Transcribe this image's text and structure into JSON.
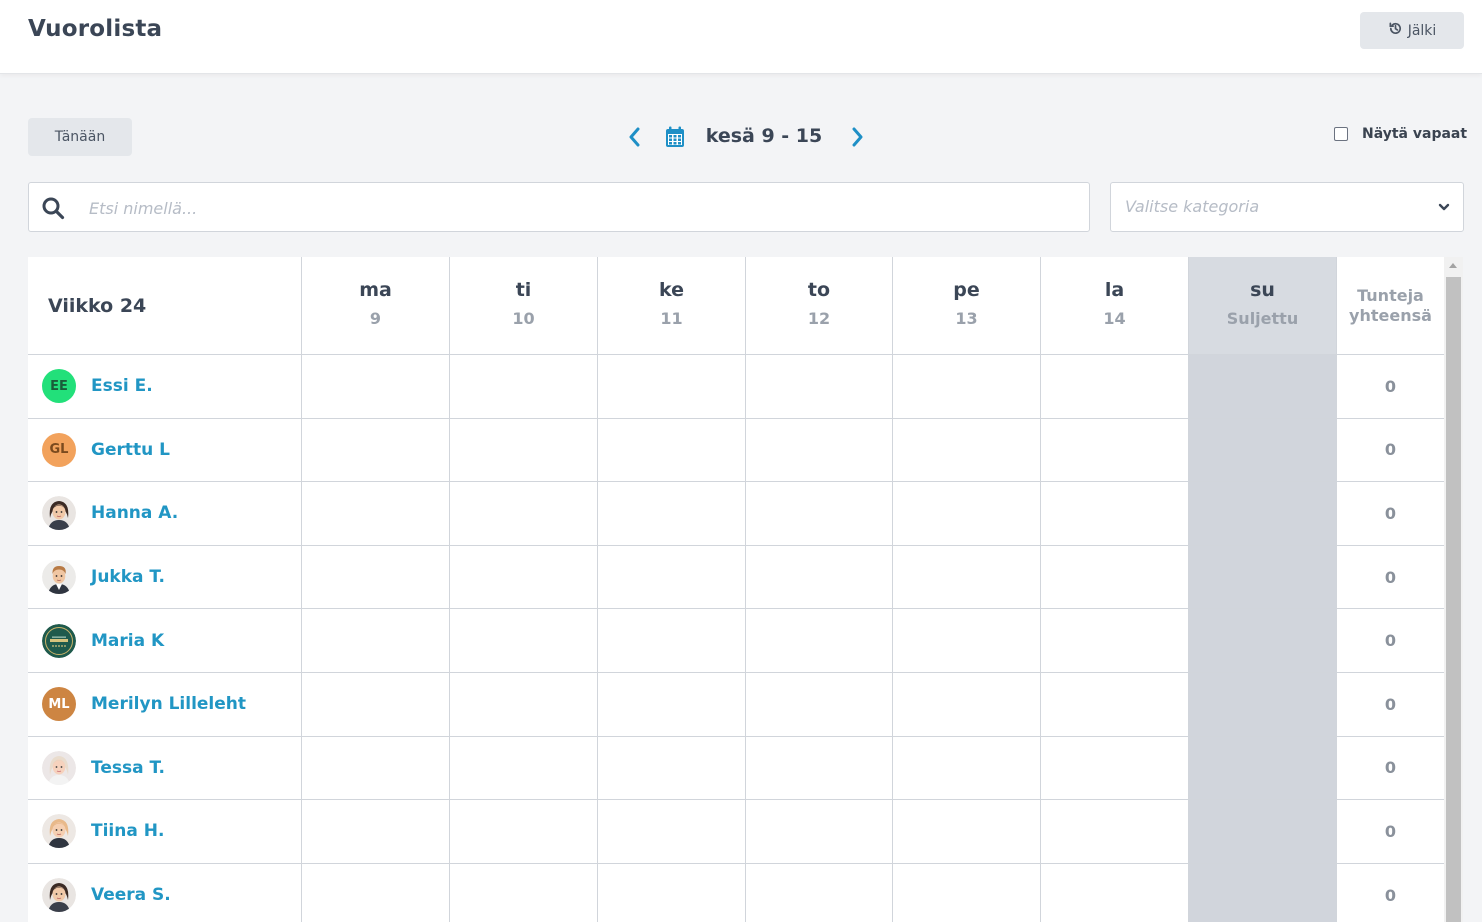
{
  "header": {
    "title": "Vuorolista",
    "back_label": "Jälki"
  },
  "toolbar": {
    "today_label": "Tänään",
    "date_range": "kesä 9 - 15",
    "show_free_label": "Näytä vapaat",
    "show_free_checked": false
  },
  "search": {
    "placeholder": "Etsi nimellä...",
    "value": ""
  },
  "category": {
    "placeholder": "Valitse kategoria"
  },
  "schedule": {
    "week_label": "Viikko 24",
    "days": [
      {
        "name": "ma",
        "number": "9",
        "closed": false
      },
      {
        "name": "ti",
        "number": "10",
        "closed": false
      },
      {
        "name": "ke",
        "number": "11",
        "closed": false
      },
      {
        "name": "to",
        "number": "12",
        "closed": false
      },
      {
        "name": "pe",
        "number": "13",
        "closed": false
      },
      {
        "name": "la",
        "number": "14",
        "closed": false
      },
      {
        "name": "su",
        "number": "Suljettu",
        "closed": true
      }
    ],
    "total_header": [
      "Tunteja",
      "yhteensä"
    ],
    "employees": [
      {
        "name": "Essi E.",
        "initials": "EE",
        "avatar_color": "#22e07a",
        "avatar_text_color": "#1a5f3a",
        "total": "0"
      },
      {
        "name": "Gerttu L",
        "initials": "GL",
        "avatar_color": "#f2a25c",
        "avatar_text_color": "#7a4a1e",
        "total": "0"
      },
      {
        "name": "Hanna A.",
        "avatar_icon": "female-avatar-dark-hair-icon",
        "total": "0"
      },
      {
        "name": "Jukka T.",
        "avatar_icon": "male-avatar-icon",
        "total": "0"
      },
      {
        "name": "Maria K",
        "avatar_icon": "badge-logo-icon",
        "total": "0"
      },
      {
        "name": "Merilyn Lilleleht",
        "initials": "ML",
        "avatar_color": "#cd8542",
        "avatar_text_color": "#ffffff",
        "total": "0"
      },
      {
        "name": "Tessa T.",
        "avatar_icon": "female-avatar-blonde-icon",
        "total": "0"
      },
      {
        "name": "Tiina H.",
        "avatar_icon": "female-avatar-light-hair-icon",
        "total": "0"
      },
      {
        "name": "Veera S.",
        "avatar_icon": "female-avatar-dark-hair-icon",
        "total": "0"
      }
    ]
  },
  "colors": {
    "accent": "#2196c4",
    "closed_bg": "#d1d5dc",
    "header_text": "#3b4656"
  }
}
